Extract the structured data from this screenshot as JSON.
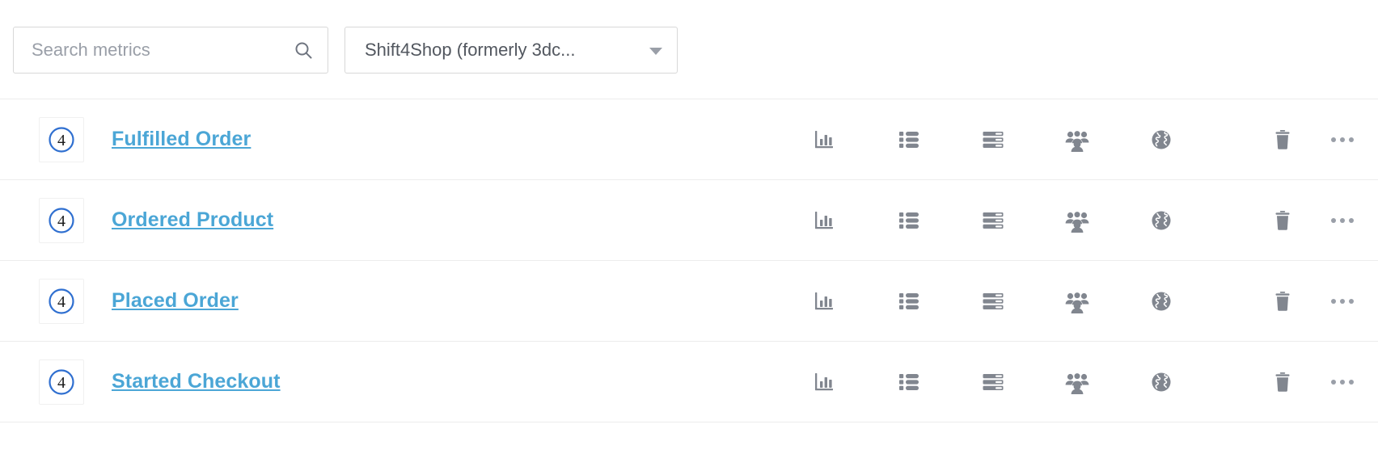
{
  "toolbar": {
    "search": {
      "placeholder": "Search metrics",
      "value": "",
      "icon": "search-icon"
    },
    "integration_filter": {
      "label": "Shift4Shop (formerly 3dc...",
      "caret_icon": "chevron-down-icon"
    }
  },
  "colors": {
    "link": "#4ba6d6",
    "icon": "#81868f",
    "logo_circle": "#2f6fd0",
    "border": "#ececec",
    "input_border": "#d8d8d8",
    "placeholder": "#9a9fa8"
  },
  "actions": [
    {
      "name": "analytics-chart-action",
      "icon": "bar-chart-icon",
      "label": ""
    },
    {
      "name": "list-view-action",
      "icon": "list-icon",
      "label": ""
    },
    {
      "name": "database-rows-action",
      "icon": "server-icon",
      "label": ""
    },
    {
      "name": "audience-group-action",
      "icon": "people-group-icon",
      "label": ""
    },
    {
      "name": "global-scope-action",
      "icon": "globe-icon",
      "label": ""
    },
    {
      "name": "delete-metric-action",
      "icon": "trash-icon",
      "label": ""
    },
    {
      "name": "more-options-action",
      "icon": "ellipsis-icon",
      "label": ""
    }
  ],
  "metrics": [
    {
      "logo_text": "4",
      "logo_alt": "shift4shop-logo",
      "name": "Fulfilled Order"
    },
    {
      "logo_text": "4",
      "logo_alt": "shift4shop-logo",
      "name": "Ordered Product"
    },
    {
      "logo_text": "4",
      "logo_alt": "shift4shop-logo",
      "name": "Placed Order"
    },
    {
      "logo_text": "4",
      "logo_alt": "shift4shop-logo",
      "name": "Started Checkout"
    }
  ]
}
